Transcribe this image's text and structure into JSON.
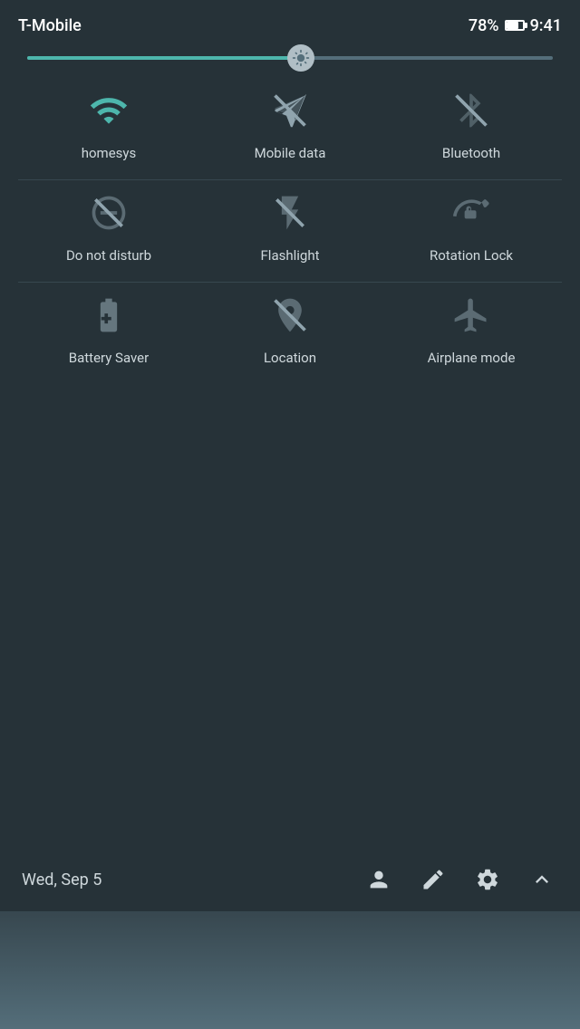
{
  "statusBar": {
    "carrier": "T-Mobile",
    "battery": "78%",
    "time": "9:41"
  },
  "brightness": {
    "fillPercent": 52
  },
  "rows": [
    {
      "tiles": [
        {
          "id": "wifi",
          "label": "homesys",
          "active": true,
          "icon": "wifi"
        },
        {
          "id": "mobile-data",
          "label": "Mobile data",
          "active": false,
          "icon": "mobile-data"
        },
        {
          "id": "bluetooth",
          "label": "Bluetooth",
          "active": false,
          "icon": "bluetooth"
        }
      ]
    },
    {
      "tiles": [
        {
          "id": "do-not-disturb",
          "label": "Do not disturb",
          "active": false,
          "icon": "dnd"
        },
        {
          "id": "flashlight",
          "label": "Flashlight",
          "active": false,
          "icon": "flashlight"
        },
        {
          "id": "rotation-lock",
          "label": "Rotation Lock",
          "active": false,
          "icon": "rotation-lock"
        }
      ]
    },
    {
      "tiles": [
        {
          "id": "battery-saver",
          "label": "Battery Saver",
          "active": false,
          "icon": "battery-saver"
        },
        {
          "id": "location",
          "label": "Location",
          "active": false,
          "icon": "location"
        },
        {
          "id": "airplane-mode",
          "label": "Airplane mode",
          "active": false,
          "icon": "airplane"
        }
      ]
    }
  ],
  "bottomBar": {
    "date": "Wed, Sep 5"
  }
}
